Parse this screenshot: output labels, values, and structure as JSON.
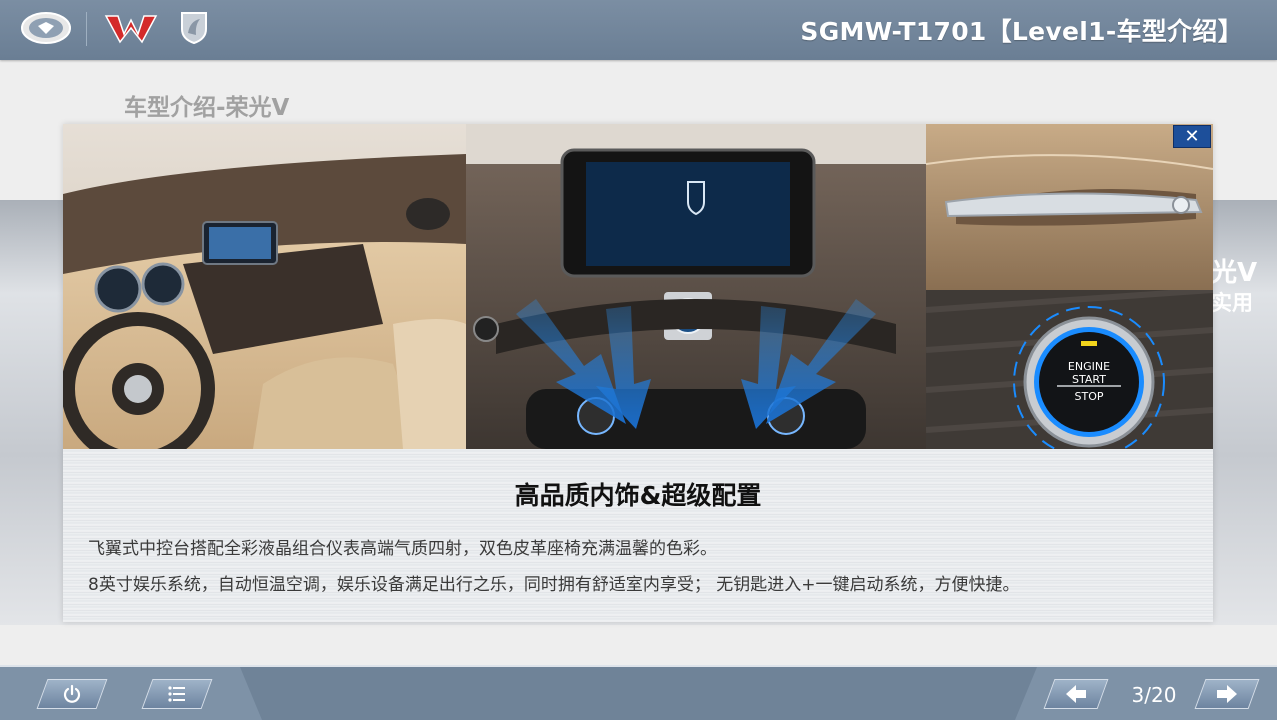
{
  "header": {
    "title": "SGMW-T1701【Level1-车型介绍】",
    "logos": [
      "sgmw-logo",
      "wuling-logo",
      "baojun-logo"
    ]
  },
  "page": {
    "heading": "车型介绍-荣光V",
    "behind_text_1": "光V",
    "behind_text_2": "实用"
  },
  "modal": {
    "close_label": "✕",
    "photos": [
      "dashboard-interior-photo",
      "center-console-ac-photo",
      "door-handle-photo",
      "engine-start-button-photo"
    ],
    "engine_button_text": [
      "ENGINE",
      "START",
      "STOP"
    ],
    "caption_title": "高品质内饰&超级配置",
    "caption_line1": "飞翼式中控台搭配全彩液晶组合仪表高端气质四射，双色皮革座椅充满温馨的色彩。",
    "caption_line2": "8英寸娱乐系统，自动恒温空调，娱乐设备满足出行之乐，同时拥有舒适室内享受； 无钥匙进入+一键启动系统，方便快捷。"
  },
  "footer": {
    "page_indicator": "3/20",
    "buttons": [
      "power-icon",
      "menu-list-icon",
      "arrow-left-icon",
      "arrow-right-icon"
    ]
  },
  "colors": {
    "header_bg": "#6f8398",
    "close_button": "#1d4f9a",
    "accent_blue": "#1a8cff"
  }
}
